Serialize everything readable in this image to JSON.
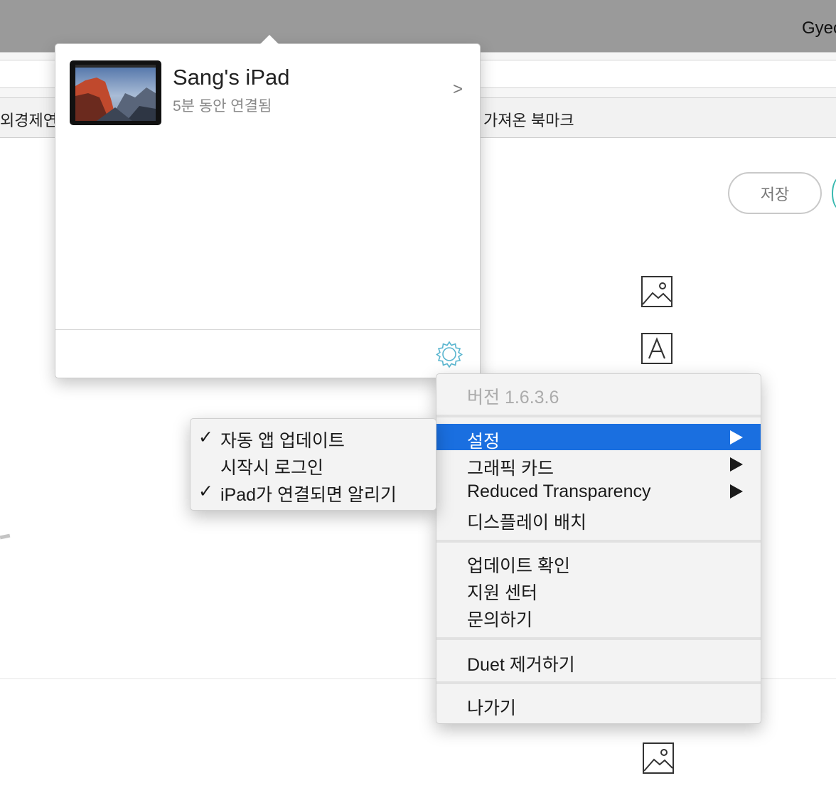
{
  "menubar": {
    "user_partial": "Gyec"
  },
  "bookmarks_bar": {
    "item_left_partial": "외경제연",
    "item_imported": "가져온 북마크"
  },
  "editor": {
    "save_label": "저장"
  },
  "popover": {
    "device_name": "Sang's iPad",
    "device_status": "5분 동안 연결됨",
    "chevron": ">"
  },
  "main_menu": {
    "version": "버전 1.6.3.6",
    "settings": "설정",
    "graphics_card": "그래픽 카드",
    "reduced_transparency": "Reduced Transparency",
    "display_arrangement": "디스플레이 배치",
    "check_updates": "업데이트 확인",
    "support_center": "지원 센터",
    "contact": "문의하기",
    "remove_duet": "Duet 제거하기",
    "quit": "나가기"
  },
  "settings_submenu": {
    "auto_update": {
      "label": "자동 앱 업데이트",
      "checked": true,
      "check": "✓"
    },
    "login_start": {
      "label": "시작시 로그인",
      "checked": false,
      "check": ""
    },
    "notify_connect": {
      "label": "iPad가 연결되면 알리기",
      "checked": true,
      "check": "✓"
    }
  },
  "colors": {
    "highlight": "#1a6fe0",
    "menubar": "#9a9a9a",
    "accent_teal": "#38b9b0"
  }
}
